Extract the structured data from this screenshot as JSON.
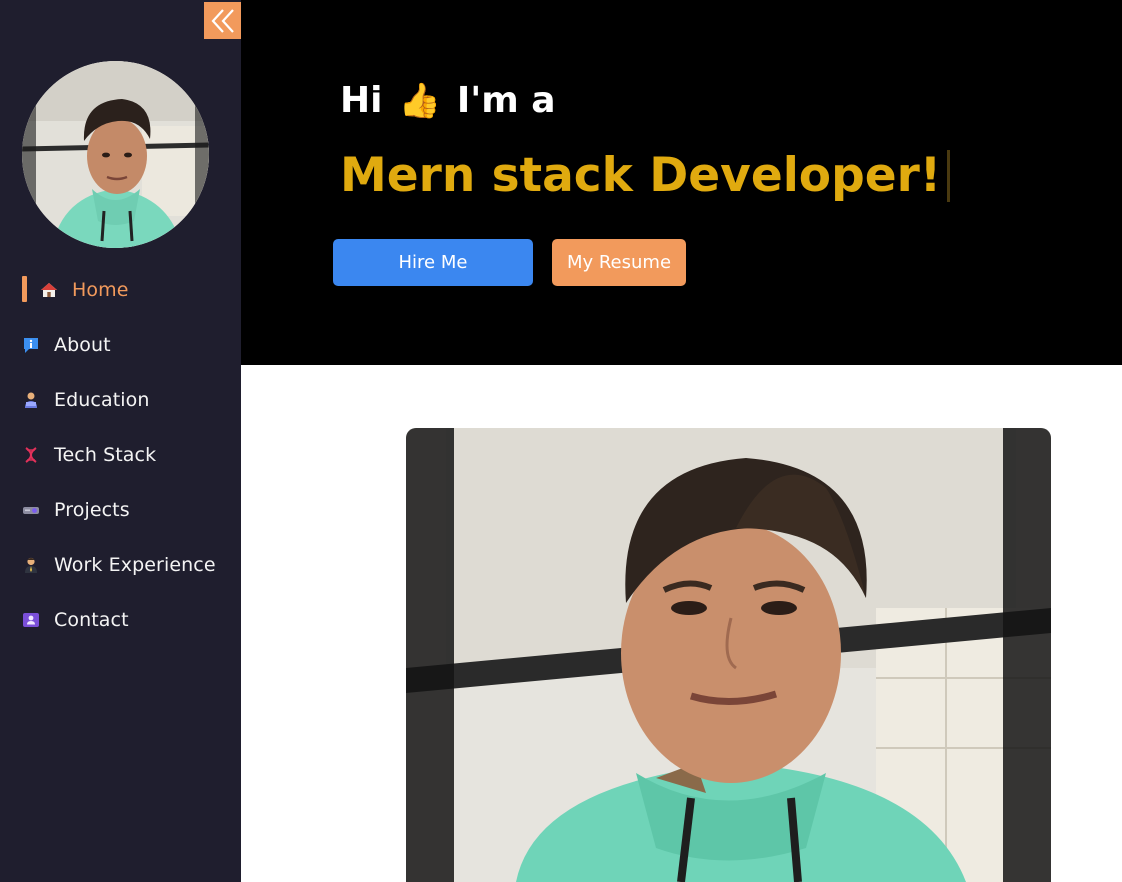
{
  "sidebar": {
    "collapse_icon": "double-chevron-left-icon",
    "items": [
      {
        "label": "Home",
        "icon": "house-icon",
        "active": true
      },
      {
        "label": "About",
        "icon": "info-icon"
      },
      {
        "label": "Education",
        "icon": "student-icon"
      },
      {
        "label": "Tech Stack",
        "icon": "dna-icon"
      },
      {
        "label": "Projects",
        "icon": "projector-icon"
      },
      {
        "label": "Work Experience",
        "icon": "worker-icon"
      },
      {
        "label": "Contact",
        "icon": "contact-card-icon"
      }
    ]
  },
  "hero": {
    "greeting_hi": "Hi",
    "greeting_emoji": "👍",
    "greeting_rest": "I'm a",
    "role": "Mern stack Developer!",
    "hire_label": "Hire Me",
    "resume_label": "My Resume"
  },
  "colors": {
    "sidebar_bg": "#1f1e2e",
    "accent": "#f29a5c",
    "hero_bg": "#000000",
    "role_text": "#e0aa0f",
    "hire_button": "#3b87f0"
  }
}
